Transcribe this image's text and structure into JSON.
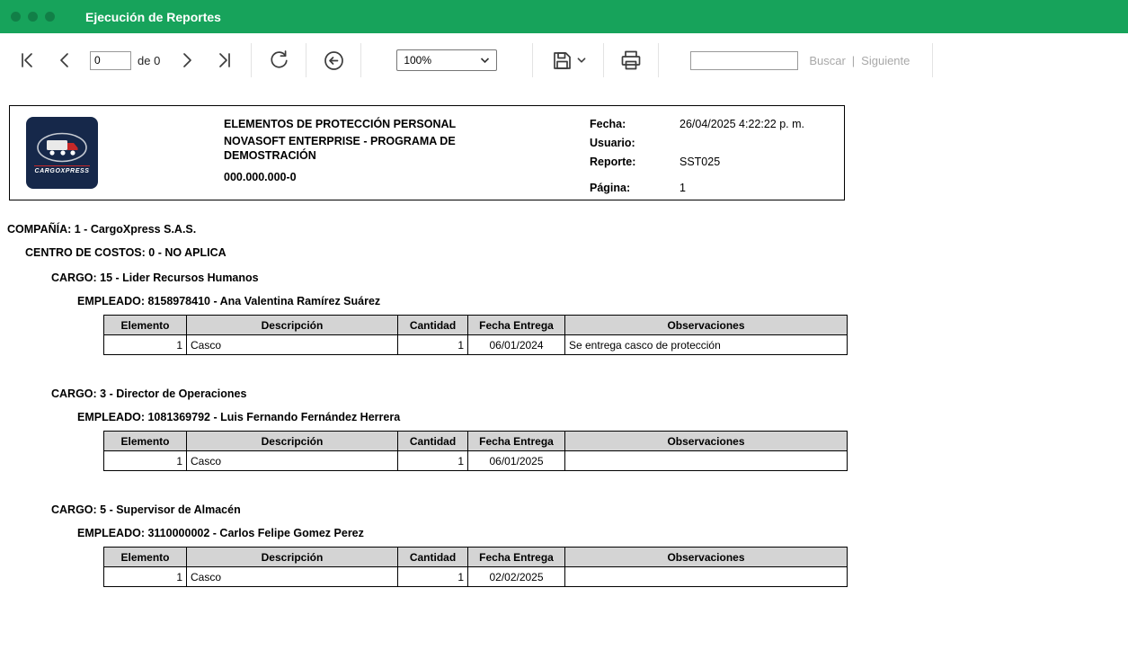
{
  "window": {
    "title": "Ejecución de Reportes"
  },
  "toolbar": {
    "page_value": "0",
    "page_of_label": "de 0",
    "zoom_value": "100%",
    "search_value": "",
    "find_label": "Buscar",
    "find_separator": "|",
    "next_label": "Siguiente"
  },
  "report": {
    "header": {
      "logo_text": "CARGOXPRESS",
      "title": "ELEMENTOS DE PROTECCIÓN PERSONAL",
      "subtitle": "NOVASOFT ENTERPRISE - PROGRAMA DE DEMOSTRACIÓN",
      "company_id": "000.000.000-0",
      "fields": [
        {
          "label": "Fecha:",
          "value": "26/04/2025 4:22:22 p. m."
        },
        {
          "label": "Usuario:",
          "value": ""
        },
        {
          "label": "Reporte:",
          "value": "SST025"
        },
        {
          "label": "Página:",
          "value": "1"
        }
      ]
    },
    "company_line": "COMPAÑÍA: 1 - CargoXpress S.A.S.",
    "cost_center_line": "CENTRO DE COSTOS: 0 - NO APLICA",
    "table_headers": [
      "Elemento",
      "Descripción",
      "Cantidad",
      "Fecha Entrega",
      "Observaciones"
    ],
    "groups": [
      {
        "cargo_label": "CARGO: 15 - Lider Recursos Humanos",
        "empleado_label": "EMPLEADO: 8158978410 - Ana Valentina Ramírez Suárez",
        "row": {
          "elemento": "1",
          "descripcion": "Casco",
          "cantidad": "1",
          "fecha_entrega": "06/01/2024",
          "observaciones": "Se entrega casco de protección"
        }
      },
      {
        "cargo_label": "CARGO: 3 - Director de Operaciones",
        "empleado_label": "EMPLEADO: 1081369792 - Luis Fernando Fernández Herrera",
        "row": {
          "elemento": "1",
          "descripcion": "Casco",
          "cantidad": "1",
          "fecha_entrega": "06/01/2025",
          "observaciones": ""
        }
      },
      {
        "cargo_label": "CARGO: 5 - Supervisor de Almacén",
        "empleado_label": "EMPLEADO: 3110000002 - Carlos Felipe Gomez Perez",
        "row": {
          "elemento": "1",
          "descripcion": "Casco",
          "cantidad": "1",
          "fecha_entrega": "02/02/2025",
          "observaciones": ""
        }
      }
    ]
  }
}
